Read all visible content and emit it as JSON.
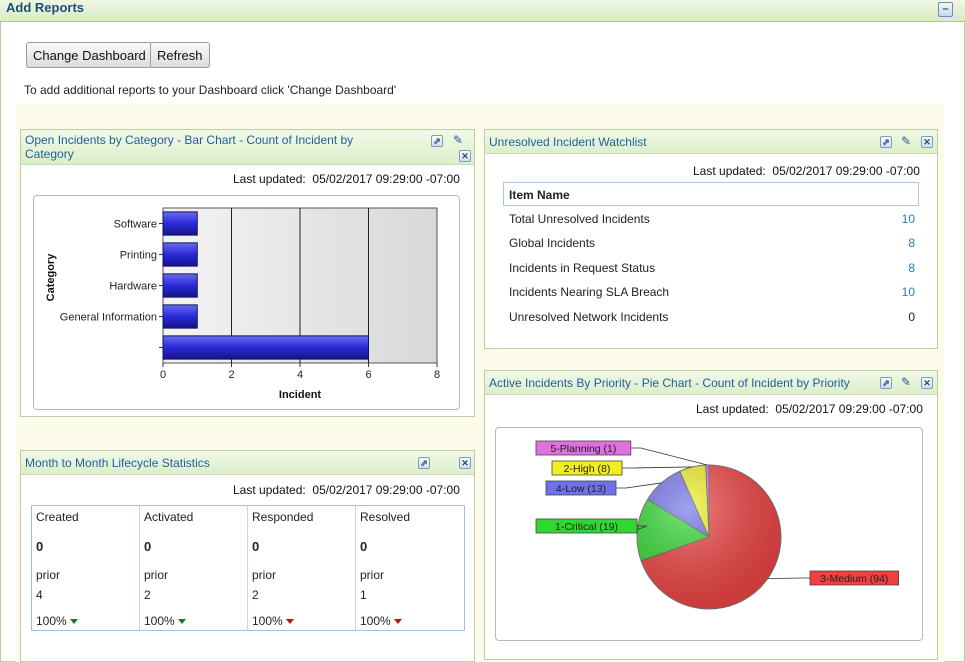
{
  "header": {
    "title": "Add Reports",
    "collapse_icon": "minus-icon",
    "collapse_label": "–"
  },
  "toolbar": {
    "change_dashboard": "Change Dashboard",
    "refresh": "Refresh"
  },
  "instructions": "To add additional reports to your Dashboard click 'Change Dashboard'",
  "last_updated_label": "Last updated:",
  "last_updated_value": "05/02/2017 09:29:00 -07:00",
  "panel_icons": {
    "popout": "popout-icon",
    "edit": "pencil-icon",
    "close": "close-icon"
  },
  "bar_panel": {
    "title_line1": "Open Incidents by Category - Bar Chart - Count of Incident by",
    "title_line2": "Category"
  },
  "watchlist_panel": {
    "title": "Unresolved Incident Watchlist",
    "column_header": "Item Name",
    "rows": [
      {
        "name": "Total Unresolved Incidents",
        "value": "10"
      },
      {
        "name": "Global Incidents",
        "value": "8"
      },
      {
        "name": "Incidents in Request Status",
        "value": "8"
      },
      {
        "name": "Incidents Nearing SLA Breach",
        "value": "10"
      },
      {
        "name": "Unresolved Network Incidents",
        "value": "0"
      }
    ]
  },
  "pie_panel": {
    "title": "Active Incidents By Priority - Pie Chart - Count of Incident by Priority"
  },
  "lifecycle_panel": {
    "title": "Month to Month Lifecycle Statistics",
    "prior_label": "prior",
    "columns": [
      {
        "header": "Created",
        "value": "0",
        "prior": "4",
        "pct": "100%",
        "trend": "down-green"
      },
      {
        "header": "Activated",
        "value": "0",
        "prior": "2",
        "pct": "100%",
        "trend": "down-green"
      },
      {
        "header": "Responded",
        "value": "0",
        "prior": "2",
        "pct": "100%",
        "trend": "down-red"
      },
      {
        "header": "Resolved",
        "value": "0",
        "prior": "1",
        "pct": "100%",
        "trend": "down-red"
      }
    ]
  },
  "chart_data": [
    {
      "type": "bar",
      "orientation": "horizontal",
      "categories": [
        "Software",
        "Printing",
        "Hardware",
        "General Information",
        ""
      ],
      "values": [
        1,
        1,
        1,
        1,
        6
      ],
      "xlabel": "Incident",
      "ylabel": "Category",
      "xlim": [
        0,
        8
      ],
      "xticks": [
        "0",
        "2",
        "4",
        "6",
        "8"
      ],
      "bar_color": "#2a2ad8",
      "grid": true
    },
    {
      "type": "pie",
      "slices": [
        {
          "label": "5-Planning (1)",
          "value": 1,
          "color": "#e070e0"
        },
        {
          "label": "2-High (8)",
          "value": 8,
          "color": "#f0f020"
        },
        {
          "label": "4-Low (13)",
          "value": 13,
          "color": "#7070e8"
        },
        {
          "label": "1-Critical (19)",
          "value": 19,
          "color": "#30d830"
        },
        {
          "label": "3-Medium (94)",
          "value": 94,
          "color": "#f04040"
        }
      ]
    }
  ]
}
